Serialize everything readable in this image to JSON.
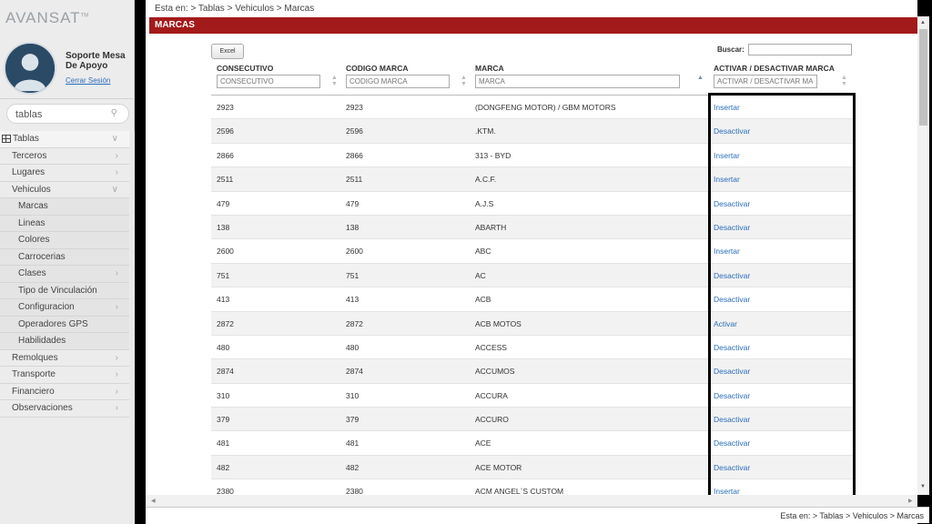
{
  "brand": {
    "logo_text": "AVANSAT",
    "logo_mark": "TM"
  },
  "user": {
    "name": "Soporte Mesa De Apoyo",
    "logout_label": "Cerrar Sesión"
  },
  "sidebar_search": {
    "value": "tablas"
  },
  "menu": [
    {
      "label": "Tablas",
      "type": "root",
      "chevron": "down"
    },
    {
      "label": "Terceros",
      "type": "item",
      "chevron": "right"
    },
    {
      "label": "Lugares",
      "type": "item",
      "chevron": "right"
    },
    {
      "label": "Vehiculos",
      "type": "item",
      "chevron": "down"
    },
    {
      "label": "Marcas",
      "type": "sub",
      "chevron": ""
    },
    {
      "label": "Lineas",
      "type": "sub",
      "chevron": ""
    },
    {
      "label": "Colores",
      "type": "sub",
      "chevron": ""
    },
    {
      "label": "Carrocerias",
      "type": "sub",
      "chevron": ""
    },
    {
      "label": "Clases",
      "type": "sub",
      "chevron": "right"
    },
    {
      "label": "Tipo de Vinculación",
      "type": "sub",
      "chevron": ""
    },
    {
      "label": "Configuracion",
      "type": "sub",
      "chevron": "right"
    },
    {
      "label": "Operadores GPS",
      "type": "sub",
      "chevron": ""
    },
    {
      "label": "Habilidades",
      "type": "sub",
      "chevron": ""
    },
    {
      "label": "Remolques",
      "type": "item",
      "chevron": "right"
    },
    {
      "label": "Transporte",
      "type": "item",
      "chevron": "right"
    },
    {
      "label": "Financiero",
      "type": "item",
      "chevron": "right"
    },
    {
      "label": "Observaciones",
      "type": "item",
      "chevron": "right"
    }
  ],
  "breadcrumb": "Esta en: > Tablas > Vehiculos > Marcas",
  "panel_title": "MARCAS",
  "toolbar": {
    "excel_label": "Excel",
    "search_label": "Buscar:",
    "search_value": ""
  },
  "table": {
    "columns": [
      {
        "label": "CONSECUTIVO",
        "filter_placeholder": "CONSECUTIVO"
      },
      {
        "label": "CODIGO MARCA",
        "filter_placeholder": "CODIGO MARCA"
      },
      {
        "label": "MARCA",
        "filter_placeholder": "MARCA",
        "sorted": "asc"
      },
      {
        "label": "ACTIVAR / DESACTIVAR MARCA",
        "filter_placeholder": "ACTIVAR / DESACTIVAR MA"
      }
    ],
    "rows": [
      [
        "2923",
        "2923",
        "(DONGFENG MOTOR) / GBM MOTORS",
        "Insertar"
      ],
      [
        "2596",
        "2596",
        ".KTM.",
        "Desactivar"
      ],
      [
        "2866",
        "2866",
        "313 - BYD",
        "Insertar"
      ],
      [
        "2511",
        "2511",
        "A.C.F.",
        "Insertar"
      ],
      [
        "479",
        "479",
        "A.J.S",
        "Desactivar"
      ],
      [
        "138",
        "138",
        "ABARTH",
        "Desactivar"
      ],
      [
        "2600",
        "2600",
        "ABC",
        "Insertar"
      ],
      [
        "751",
        "751",
        "AC",
        "Desactivar"
      ],
      [
        "413",
        "413",
        "ACB",
        "Desactivar"
      ],
      [
        "2872",
        "2872",
        "ACB MOTOS",
        "Activar"
      ],
      [
        "480",
        "480",
        "ACCESS",
        "Desactivar"
      ],
      [
        "2874",
        "2874",
        "ACCUMOS",
        "Desactivar"
      ],
      [
        "310",
        "310",
        "ACCURA",
        "Desactivar"
      ],
      [
        "379",
        "379",
        "ACCURO",
        "Desactivar"
      ],
      [
        "481",
        "481",
        "ACE",
        "Desactivar"
      ],
      [
        "482",
        "482",
        "ACE MOTOR",
        "Desactivar"
      ],
      [
        "2380",
        "2380",
        "ACM ANGEL`S CUSTOM",
        "Insertar"
      ]
    ]
  },
  "footer_breadcrumb": "Esta en: > Tablas > Vehiculos > Marcas",
  "colors": {
    "title_bar": "#a31a1a",
    "link": "#2a6ebb",
    "highlight_border": "#000000"
  }
}
